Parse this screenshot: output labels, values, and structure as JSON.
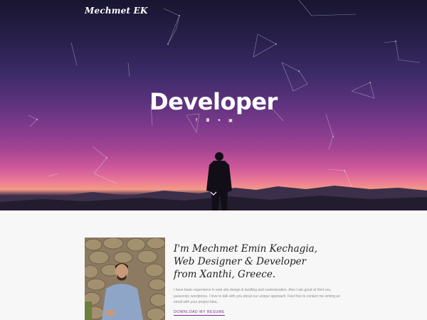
{
  "header": {
    "brand": "Mechmet EK"
  },
  "hero": {
    "title": "Developer",
    "social_icons": [
      {
        "name": "facebook-icon",
        "glyph": "f"
      },
      {
        "name": "instagram-icon",
        "glyph": "◘"
      },
      {
        "name": "twitter-icon",
        "glyph": "✦"
      },
      {
        "name": "linkedin-icon",
        "glyph": "▣"
      }
    ],
    "scroll_icon": "chevron-down-icon"
  },
  "about": {
    "heading_lines": [
      "I'm Mechmet Emin Kechagia,",
      "Web Designer & Developer",
      "from Xanthi, Greece."
    ],
    "description": "I have basic experience in web site design & building and customization. Also I am good at html css, javascript, wordpress. I love to talk with you about our unique approach. Feel free to contact me writing an email with your project idea.",
    "resume_link": "Download my resume"
  },
  "colors": {
    "accent": "#7d2a8c",
    "text_dark": "#1e1e1e",
    "text_muted": "#8e8e8e",
    "page_bg": "#f7f7f7"
  }
}
